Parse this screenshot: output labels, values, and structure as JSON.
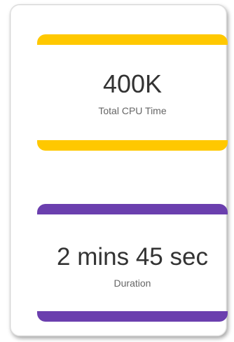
{
  "cards": [
    {
      "value": "400K",
      "label": "Total CPU Time",
      "accent_color": "#FFC800"
    },
    {
      "value": "2 mins 45 sec",
      "label": "Duration",
      "accent_color": "#6B3FAE"
    }
  ]
}
